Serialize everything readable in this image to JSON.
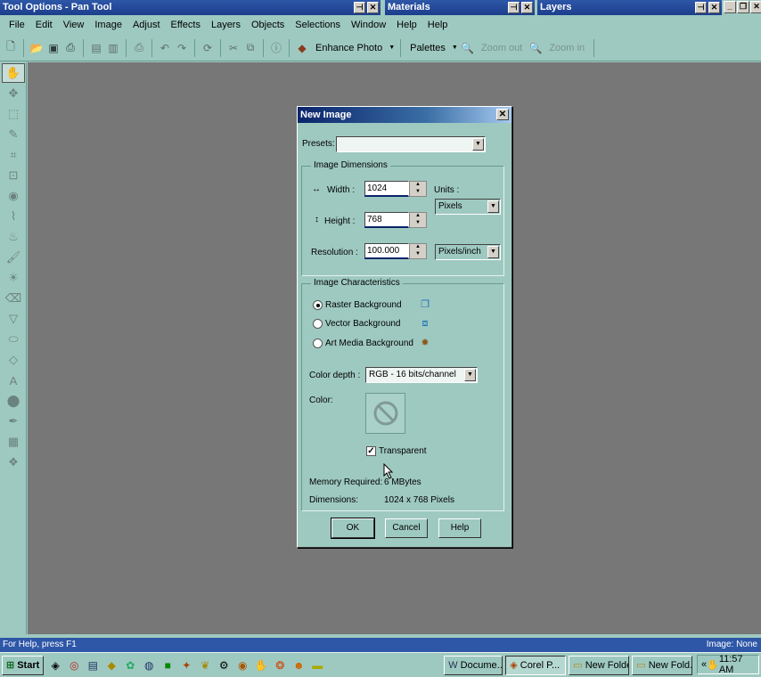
{
  "windows": {
    "tool_options_title": "Tool Options - Pan Tool",
    "materials_title": "Materials",
    "layers_title": "Layers"
  },
  "menubar": {
    "items": [
      "File",
      "Edit",
      "View",
      "Image",
      "Adjust",
      "Effects",
      "Layers",
      "Objects",
      "Selections",
      "Window",
      "Help",
      "Help"
    ]
  },
  "toolbar": {
    "enhance_photo": "Enhance Photo",
    "palettes": "Palettes",
    "zoom_out": "Zoom out",
    "zoom_in": "Zoom in"
  },
  "dialog": {
    "title": "New Image",
    "presets_label": "Presets:",
    "presets_value": "",
    "dimensions_group": "Image Dimensions",
    "width_label": "Width :",
    "width_value": "1024",
    "height_label": "Height :",
    "height_value": "768",
    "units_label": "Units :",
    "units_value": "Pixels",
    "resolution_label": "Resolution :",
    "resolution_value": "100.000",
    "resolution_units": "Pixels/inch",
    "characteristics_group": "Image Characteristics",
    "raster_bg": "Raster Background",
    "vector_bg": "Vector Background",
    "art_media_bg": "Art Media Background",
    "color_depth_label": "Color depth :",
    "color_depth_value": "RGB - 16 bits/channel",
    "color_label": "Color:",
    "transparent_label": "Transparent",
    "transparent_checked": true,
    "memory_label": "Memory Required:",
    "memory_value": "6 MBytes",
    "dimensions_label": "Dimensions:",
    "dimensions_value": "1024 x 768 Pixels",
    "ok": "OK",
    "cancel": "Cancel",
    "help": "Help"
  },
  "status": {
    "left": "For Help, press F1",
    "right": "Image: None"
  },
  "taskbar": {
    "start": "Start",
    "tasks": [
      "Docume...",
      "Corel P...",
      "New Folder",
      "New Fold..."
    ],
    "time": "11:57 AM"
  },
  "colors": {
    "panel": "#9ec9c0",
    "workspace": "#777777",
    "title_blue": "#2e57a8"
  }
}
